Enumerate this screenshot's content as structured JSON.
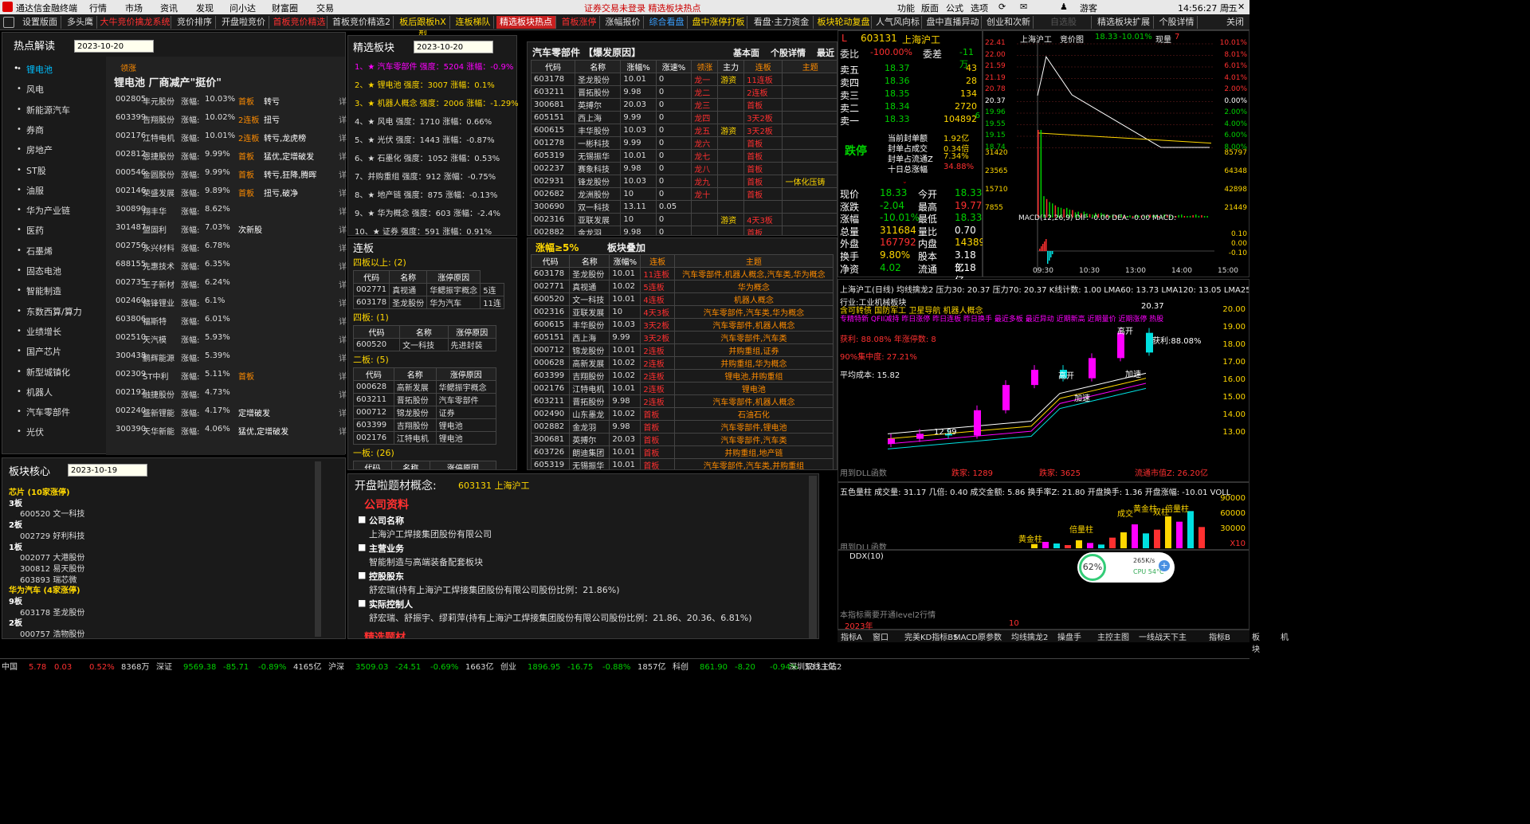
{
  "app": {
    "title": "通达信金融终端",
    "menu": [
      "行情",
      "市场",
      "资讯",
      "发现",
      "问小达",
      "财富圈",
      "交易"
    ],
    "notice": "证券交易未登录  精选板块热点",
    "right_menu": [
      "功能",
      "版面",
      "公式",
      "选项"
    ],
    "user": "游客",
    "clock": "14:56:27 周五"
  },
  "tabs": [
    "设置版面",
    "多头鹰",
    "大牛竞价擒龙系统",
    "竞价排序",
    "开盘啦竞价",
    "首板竞价精选",
    "首板竞价精选2",
    "板后跟板hX型",
    "连板梯队",
    "精选板块热点",
    "首板涨停",
    "涨幅报价",
    "综合看盘",
    "盘中涨停打板",
    "看盘·主力资金",
    "板块轮动复盘",
    "人气风向标",
    "盘中直播异动",
    "创业和次新",
    "自选股",
    "精选板块扩展",
    "个股详情",
    "关闭"
  ],
  "hot": {
    "title": "热点解读",
    "date": "2023-10-20",
    "sectors": [
      "锂电池",
      "风电",
      "新能源汽车",
      "券商",
      "房地产",
      "ST股",
      "油服",
      "华为产业链",
      "医药",
      "石墨烯",
      "固态电池",
      "智能制造",
      "东数西算/算力",
      "业绩增长",
      "国产芯片",
      "新型城镇化",
      "机器人",
      "汽车零部件",
      "光伏"
    ],
    "lead_label": "领涨",
    "headline": "锂电池  厂商减产\"挺价\"",
    "more": "详",
    "stocks": [
      [
        "002805",
        "丰元股份",
        "10.03%",
        "首板",
        "转亏"
      ],
      [
        "603399",
        "吉翔股份",
        "10.02%",
        "2连板",
        "扭亏"
      ],
      [
        "002176",
        "江特电机",
        "10.01%",
        "2连板",
        "转亏,龙虎榜"
      ],
      [
        "002812",
        "恩捷股份",
        "9.99%",
        "首板",
        "猛优,定增破发"
      ],
      [
        "000546",
        "金圆股份",
        "9.99%",
        "首板",
        "转亏,狂降,腾晖"
      ],
      [
        "002146",
        "荣盛发展",
        "9.89%",
        "首板",
        "扭亏,破净"
      ],
      [
        "300890",
        "翔丰华",
        "8.62%",
        "",
        ""
      ],
      [
        "301487",
        "盟固利",
        "7.03%",
        "",
        "次新股"
      ],
      [
        "002756",
        "永兴材料",
        "6.78%",
        "",
        ""
      ],
      [
        "688155",
        "先惠技术",
        "6.35%",
        "",
        ""
      ],
      [
        "002735",
        "王子新材",
        "6.24%",
        "",
        ""
      ],
      [
        "002460",
        "赣锋锂业",
        "6.1%",
        "",
        ""
      ],
      [
        "603806",
        "福斯特",
        "6.01%",
        "",
        ""
      ],
      [
        "002510",
        "天汽模",
        "5.93%",
        "",
        ""
      ],
      [
        "300438",
        "鹏辉能源",
        "5.39%",
        "",
        ""
      ],
      [
        "002309",
        "ST中利",
        "5.11%",
        "首板",
        ""
      ],
      [
        "002192",
        "融捷股份",
        "4.73%",
        "",
        ""
      ],
      [
        "002240",
        "盛新锂能",
        "4.17%",
        "",
        "定增破发"
      ],
      [
        "300390",
        "天华新能",
        "4.06%",
        "",
        "猛优,定增破发"
      ]
    ],
    "rise_label": "涨幅:"
  },
  "selected": {
    "title": "精选板块",
    "date": "2023-10-20",
    "items": [
      "1、★ 汽车零部件 强度：5204 涨幅：-0.9%",
      "2、★ 锂电池 强度：3007 涨幅：0.1%",
      "3、★ 机器人概念 强度：2006 涨幅：-1.29%",
      "4、★ 风电 强度：1710 涨幅：0.66%",
      "5、★ 光伏 强度：1443 涨幅：-0.87%",
      "6、★ 石墨化 强度：1052 涨幅：0.53%",
      "7、并购重组 强度：912 涨幅：-0.75%",
      "8、★ 地产链 强度：875 涨幅：-0.13%",
      "9、★ 华为概念 强度：603 涨幅：-2.4%",
      "10、★ 证券 强度：591 涨幅：0.91%"
    ]
  },
  "lianban": {
    "title": "连板",
    "g4": "四板以上: (2)",
    "g4rows": [
      [
        "002771",
        "真视通",
        "华鳃振宇概念",
        "5连"
      ],
      [
        "603178",
        "圣龙股份",
        "华为汽车",
        "11连"
      ]
    ],
    "g3": "四板: (1)",
    "g3rows": [
      [
        "600520",
        "文一科技",
        "先进封装"
      ]
    ],
    "g2": "二板: (5)",
    "g2rows": [
      [
        "000628",
        "高新发展",
        "华鳃振宇概念"
      ],
      [
        "603211",
        "晋拓股份",
        "汽车零部件"
      ],
      [
        "000712",
        "锦龙股份",
        "证券"
      ],
      [
        "603399",
        "吉翔股份",
        "锂电池"
      ],
      [
        "002176",
        "江特电机",
        "锂电池"
      ]
    ],
    "g1": "一板: (26)",
    "headers": [
      "代码",
      "名称",
      "涨停原因"
    ]
  },
  "parts": {
    "title": "汽车零部件  【爆发原因】",
    "links": [
      "基本面",
      "个股详情",
      "最近"
    ],
    "headers": [
      "代码",
      "名称",
      "涨幅%",
      "涨速%",
      "领涨",
      "主力",
      "连板",
      "主题"
    ],
    "rows": [
      [
        "603178",
        "圣龙股份",
        "10.01",
        "0",
        "龙一",
        "游资",
        "11连板",
        ""
      ],
      [
        "603211",
        "晋拓股份",
        "9.98",
        "0",
        "龙二",
        "",
        "2连板",
        ""
      ],
      [
        "300681",
        "英搏尔",
        "20.03",
        "0",
        "龙三",
        "",
        "首板",
        ""
      ],
      [
        "605151",
        "西上海",
        "9.99",
        "0",
        "龙四",
        "",
        "3天2板",
        ""
      ],
      [
        "600615",
        "丰华股份",
        "10.03",
        "0",
        "龙五",
        "游资",
        "3天2板",
        ""
      ],
      [
        "001278",
        "一彬科技",
        "9.99",
        "0",
        "龙六",
        "",
        "首板",
        ""
      ],
      [
        "605319",
        "无锡振华",
        "10.01",
        "0",
        "龙七",
        "",
        "首板",
        ""
      ],
      [
        "002237",
        "赛象科技",
        "9.98",
        "0",
        "龙八",
        "",
        "首板",
        ""
      ],
      [
        "002931",
        "锋龙股份",
        "10.03",
        "0",
        "龙九",
        "",
        "首板",
        "一体化压铸"
      ],
      [
        "002682",
        "龙洲股份",
        "10",
        "0",
        "龙十",
        "",
        "首板",
        ""
      ],
      [
        "300690",
        "双一科技",
        "13.11",
        "0.05",
        "",
        "",
        "",
        ""
      ],
      [
        "002316",
        "亚联发展",
        "10",
        "0",
        "",
        "游资",
        "4天3板",
        ""
      ],
      [
        "002882",
        "金龙羽",
        "9.98",
        "0",
        "",
        "",
        "首板",
        ""
      ]
    ]
  },
  "zf5": {
    "title": "涨幅≥5%",
    "sub": "板块叠加",
    "headers": [
      "代码",
      "名称",
      "涨幅%",
      "连板",
      "主题"
    ],
    "rows": [
      [
        "603178",
        "圣龙股份",
        "10.01",
        "11连板",
        "汽车零部件,机器人概念,汽车类,华为概念"
      ],
      [
        "002771",
        "真视通",
        "10.02",
        "5连板",
        "华为概念"
      ],
      [
        "600520",
        "文一科技",
        "10.01",
        "4连板",
        "机器人概念"
      ],
      [
        "002316",
        "亚联发展",
        "10",
        "4天3板",
        "汽车零部件,汽车类,华为概念"
      ],
      [
        "600615",
        "丰华股份",
        "10.03",
        "3天2板",
        "汽车零部件,机器人概念"
      ],
      [
        "605151",
        "西上海",
        "9.99",
        "3天2板",
        "汽车零部件,汽车类"
      ],
      [
        "000712",
        "锦龙股份",
        "10.01",
        "2连板",
        "并购重组,证券"
      ],
      [
        "000628",
        "高新发展",
        "10.02",
        "2连板",
        "并购重组,华为概念"
      ],
      [
        "603399",
        "吉翔股份",
        "10.02",
        "2连板",
        "锂电池,并购重组"
      ],
      [
        "002176",
        "江特电机",
        "10.01",
        "2连板",
        "锂电池"
      ],
      [
        "603211",
        "晋拓股份",
        "9.98",
        "2连板",
        "汽车零部件,机器人概念"
      ],
      [
        "002490",
        "山东墨龙",
        "10.02",
        "首板",
        "石油石化"
      ],
      [
        "002882",
        "金龙羽",
        "9.98",
        "首板",
        "汽车零部件,锂电池"
      ],
      [
        "300681",
        "英搏尔",
        "20.03",
        "首板",
        "汽车零部件,汽车类"
      ],
      [
        "603726",
        "朗迪集团",
        "10.01",
        "首板",
        "并购重组,地产链"
      ],
      [
        "605319",
        "无锡振华",
        "10.01",
        "首板",
        "汽车零部件,汽车类,并购重组"
      ]
    ]
  },
  "core": {
    "title": "板块核心",
    "date": "2023-10-19",
    "lines": [
      [
        "y",
        "芯片 (10家涨停)"
      ],
      [
        "w",
        "3板"
      ],
      [
        "s",
        "600520 文一科技"
      ],
      [
        "w",
        "2板"
      ],
      [
        "s",
        "002729 好利科技"
      ],
      [
        "w",
        "1板"
      ],
      [
        "s",
        "002077 大港股份"
      ],
      [
        "s",
        "300812 易天股份"
      ],
      [
        "s",
        "603893 瑞芯微"
      ],
      [
        "y",
        "华为汽车 (4家涨停)"
      ],
      [
        "w",
        "9板"
      ],
      [
        "s",
        "603178 圣龙股份"
      ],
      [
        "w",
        "2板"
      ],
      [
        "s",
        "000757 浩物股份"
      ],
      [
        "s",
        "603158 腾龙股份"
      ]
    ]
  },
  "info": {
    "title": "开盘啦题材概念:",
    "code": "603131 上海沪工",
    "section": "公司资料",
    "items": [
      [
        "公司名称",
        "上海沪工焊接集团股份有限公司"
      ],
      [
        "主营业务",
        "智能制造与高端装备配套板块"
      ],
      [
        "控股股东",
        "舒宏瑞(持有上海沪工焊接集团股份有限公司股份比例：21.86%)"
      ],
      [
        "实际控制人",
        "舒宏瑞、舒振宇、缪莉萍(持有上海沪工焊接集团股份有限公司股份比例：21.86、20.36、6.81%)"
      ]
    ],
    "next": "精选题材"
  },
  "quote": {
    "code": "603131",
    "name": "上海沪工",
    "weibi": "委比",
    "weibi_v": "-100.00%",
    "weicha": "委差",
    "weicha_v": "-11万",
    "asks": [
      [
        "卖五",
        "18.37",
        "43"
      ],
      [
        "卖四",
        "18.36",
        "28"
      ],
      [
        "卖三",
        "18.35",
        "134"
      ],
      [
        "卖二",
        "18.34",
        "2720"
      ],
      [
        "卖一",
        "18.33",
        "104892"
      ]
    ],
    "bid_note": "-6",
    "status": "跌停",
    "seal": [
      [
        "当前封单额",
        "1.92亿"
      ],
      [
        "封单占成交",
        "0.34倍"
      ],
      [
        "封单占流通Z",
        "7.34%"
      ],
      [
        "十日总涨幅",
        "34.88%"
      ]
    ],
    "stats": [
      [
        "现价",
        "18.33",
        "今开",
        "18.33"
      ],
      [
        "涨跌",
        "-2.04",
        "最高",
        "19.77"
      ],
      [
        "涨幅",
        "-10.01%",
        "最低",
        "18.33"
      ],
      [
        "总量",
        "311684",
        "量比",
        "0.70"
      ],
      [
        "外盘",
        "167792",
        "内盘",
        "143892"
      ],
      [
        "换手",
        "9.80%",
        "股本",
        "3.18亿"
      ],
      [
        "净资",
        "4.02",
        "流通",
        "3.18亿"
      ]
    ]
  },
  "intraday": {
    "title": "上海沪工",
    "sub": "竞价图",
    "price": "18.33",
    "pct": "-10.01%",
    "vol_label": "现量",
    "vol": "7",
    "left_ticks": [
      "22.41",
      "22.00",
      "21.59",
      "21.19",
      "20.78",
      "20.37",
      "19.96",
      "19.55",
      "19.15",
      "18.74",
      "31420",
      "23565",
      "15710",
      "7855"
    ],
    "right_ticks": [
      "10.01%",
      "8.01%",
      "6.01%",
      "4.01%",
      "2.00%",
      "0.00%",
      "2.00%",
      "4.00%",
      "6.00%",
      "8.00%",
      "85797",
      "64348",
      "42898",
      "21449"
    ],
    "macd": "MACD(12,26,9)  DIF: -0.00  DEA: -0.00  MACD:",
    "macd_ticks": [
      "0.10",
      "0.00",
      "-0.10"
    ],
    "times": [
      "09:30",
      "10:30",
      "13:00",
      "14:00",
      "15:00"
    ],
    "chart_data": {
      "type": "line",
      "x": [
        "09:30",
        "10:30",
        "13:00",
        "14:00",
        "15:00"
      ],
      "values": [
        20.37,
        21.8,
        20.1,
        18.9,
        18.33
      ],
      "ylim": [
        18.33,
        22.41
      ]
    }
  },
  "kline": {
    "header": "上海沪工(日线)  均线擒龙2  压力30: 20.37  压力70: 20.37  K线计数: 1.00  LMA60: 13.73  LMA120: 13.05  LMA250:",
    "l1": "行业:工业机械板块",
    "l2": "含可转债 国防军工 卫星导航 机器人概念",
    "l3": "专精特新 QFII减持 昨日涨停 昨日连板 昨日换手 最近多板 最近异动 近期新高 近期量价 近期涨停 热股",
    "l4": "获利: 88.08%     年涨停数: 8",
    "l5": "90%集中度: 27.21%",
    "l6": "平均成本: 15.82",
    "ticks": [
      "20.00",
      "19.00",
      "18.00",
      "17.00",
      "16.00",
      "15.00",
      "14.00",
      "13.00"
    ],
    "ann": [
      "20.37",
      "高开",
      "获利:88.08%",
      "加速",
      "高开",
      "加速",
      "12.99"
    ],
    "foot": [
      "用到DLL函数",
      "跌家: 1289",
      "跌家: 3625",
      "流通市值Z: 26.20亿"
    ],
    "chart_data": {
      "type": "bar",
      "categories": [
        "1",
        "2",
        "3",
        "4",
        "5",
        "6",
        "7",
        "8",
        "9",
        "10"
      ],
      "values": [
        13.2,
        13.5,
        13.4,
        14.9,
        16.4,
        17.3,
        16.8,
        18.0,
        19.5,
        18.33
      ],
      "ylim": [
        12,
        21
      ]
    }
  },
  "vol": {
    "header": "五色量柱  成交量: 31.17  几倍: 0.40  成交金额: 5.86  换手率Z: 21.80  开盘换手: 1.36  开盘涨幅: -10.01  VOLL",
    "ticks": [
      "90000",
      "60000",
      "30000",
      "X10"
    ],
    "ann": [
      "黄金柱",
      "倍量柱",
      "成交",
      "黄金柱",
      "双柱",
      "倍量柱"
    ],
    "foot": "用到DLL函数",
    "chart_data": {
      "type": "bar",
      "categories": [
        "1",
        "2",
        "3",
        "4",
        "5",
        "6",
        "7",
        "8",
        "9",
        "10",
        "11",
        "12",
        "13",
        "14",
        "15",
        "16"
      ],
      "values": [
        8000,
        12000,
        9000,
        6000,
        15000,
        10000,
        7000,
        20000,
        30000,
        45000,
        28000,
        35000,
        60000,
        50000,
        70000,
        40000
      ]
    }
  },
  "ddx": {
    "title": "DDX(10)",
    "note": "本指标需要开通level2行情",
    "years": [
      "2023年",
      "10"
    ]
  },
  "badge": {
    "pct": "62%",
    "speed": "265K/s",
    "cpu": "CPU 54°C"
  },
  "bottom_tabs": [
    "指标A",
    "窗口",
    "完美KD指标BS",
    "MACD原参数",
    "均线擒龙2",
    "操盘手",
    "主控主图",
    "一线战天下主",
    "指标B",
    "板块",
    "机"
  ],
  "status": [
    [
      "中国",
      "w"
    ],
    [
      "5.78",
      "r"
    ],
    [
      "0.03",
      "r"
    ],
    [
      "0.52%",
      "r"
    ],
    [
      "8368万",
      "w"
    ],
    [
      "深证",
      "w"
    ],
    [
      "9569.38",
      "g"
    ],
    [
      "-85.71",
      "g"
    ],
    [
      "-0.89%",
      "g"
    ],
    [
      "4165亿",
      "w"
    ],
    [
      "沪深",
      "w"
    ],
    [
      "3509.03",
      "g"
    ],
    [
      "-24.51",
      "g"
    ],
    [
      "-0.69%",
      "g"
    ],
    [
      "1663亿",
      "w"
    ],
    [
      "创业",
      "w"
    ],
    [
      "1896.95",
      "g"
    ],
    [
      "-16.75",
      "g"
    ],
    [
      "-0.88%",
      "g"
    ],
    [
      "1857亿",
      "w"
    ],
    [
      "科创",
      "w"
    ],
    [
      "861.90",
      "g"
    ],
    [
      "-8.20",
      "g"
    ],
    [
      "-0.94%",
      "g"
    ],
    [
      "533.1亿",
      "w"
    ],
    [
      "深圳双线主站2",
      "w"
    ]
  ]
}
